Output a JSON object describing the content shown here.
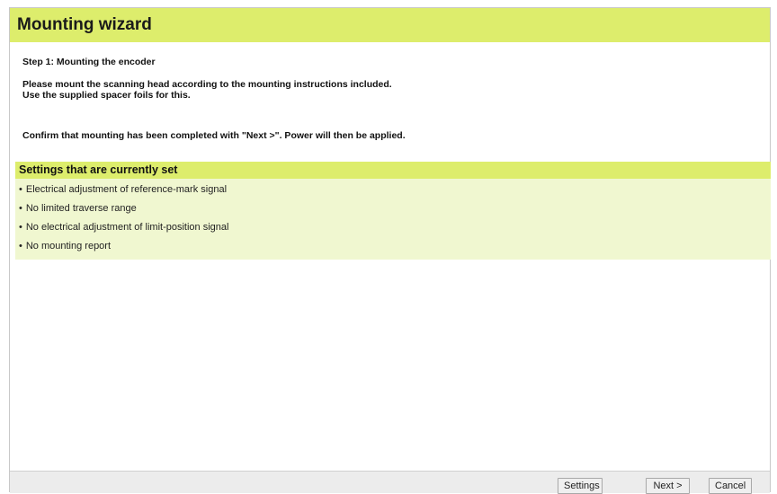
{
  "window": {
    "title": "Mounting wizard"
  },
  "step": {
    "title": "Step 1: Mounting the encoder",
    "instruction_line1": "Please mount the scanning head according to the mounting instructions included.",
    "instruction_line2": "Use the supplied spacer foils for this.",
    "confirm": "Confirm that mounting has been completed with \"Next >\". Power will then be applied."
  },
  "settings": {
    "header": "Settings that are currently set",
    "items": [
      {
        "label": "Electrical adjustment of reference-mark signal"
      },
      {
        "label": "No limited traverse range"
      },
      {
        "label": "No electrical adjustment of limit-position signal"
      },
      {
        "label": "No mounting report"
      }
    ]
  },
  "footer": {
    "settings_label": "Settings",
    "next_label": "Next >",
    "cancel_label": "Cancel"
  },
  "colors": {
    "accent": "#dded6c",
    "panel": "#f0f7d0"
  }
}
